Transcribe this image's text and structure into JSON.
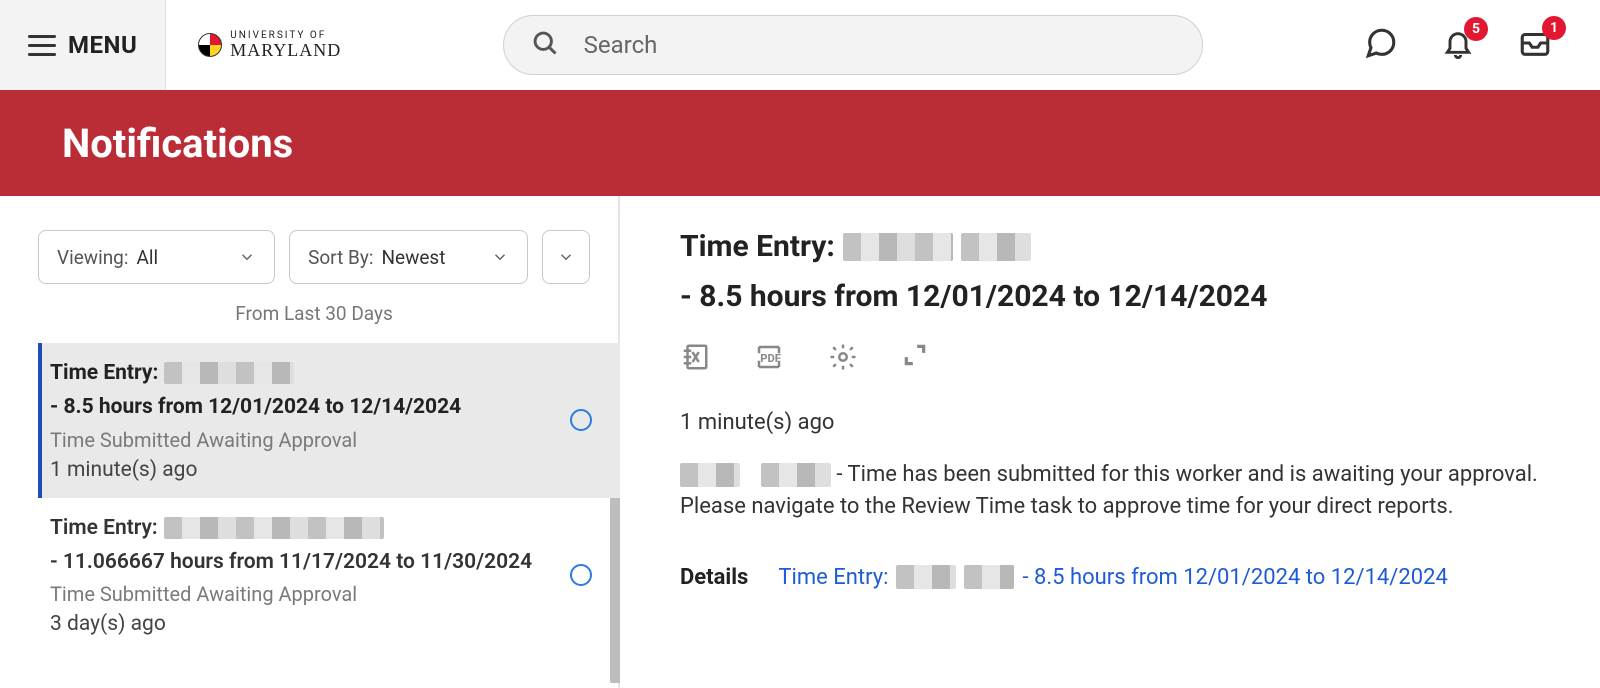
{
  "header": {
    "menu_label": "MENU",
    "logo_top": "UNIVERSITY OF",
    "logo_bottom": "MARYLAND",
    "search_placeholder": "Search",
    "badges": {
      "bell": "5",
      "inbox": "1"
    }
  },
  "banner": {
    "title": "Notifications"
  },
  "filters": {
    "viewing_label": "Viewing:",
    "viewing_value": "All",
    "sortby_label": "Sort By:",
    "sortby_value": "Newest",
    "range_hint": "From Last 30 Days"
  },
  "list": [
    {
      "prefix": "Time Entry:",
      "redacted_w": 130,
      "suffix": " - 8.5 hours from 12/01/2024 to 12/14/2024",
      "status": "Time Submitted Awaiting Approval",
      "ago": "1 minute(s) ago",
      "selected": true
    },
    {
      "prefix": "Time Entry:",
      "redacted_w": 220,
      "suffix": " - 11.066667 hours from 11/17/2024 to 11/30/2024",
      "status": "Time Submitted Awaiting Approval",
      "ago": "3 day(s) ago",
      "selected": false
    }
  ],
  "detail": {
    "title_prefix": "Time Entry:",
    "title_suffix": " - 8.5 hours from 12/01/2024 to 12/14/2024",
    "ago": "1 minute(s) ago",
    "message_suffix": " - Time has been submitted for this worker and is awaiting your approval. Please navigate to the Review Time task to approve time for your direct reports.",
    "details_label": "Details",
    "link_prefix": "Time Entry:",
    "link_suffix": " - 8.5 hours from 12/01/2024 to 12/14/2024"
  }
}
